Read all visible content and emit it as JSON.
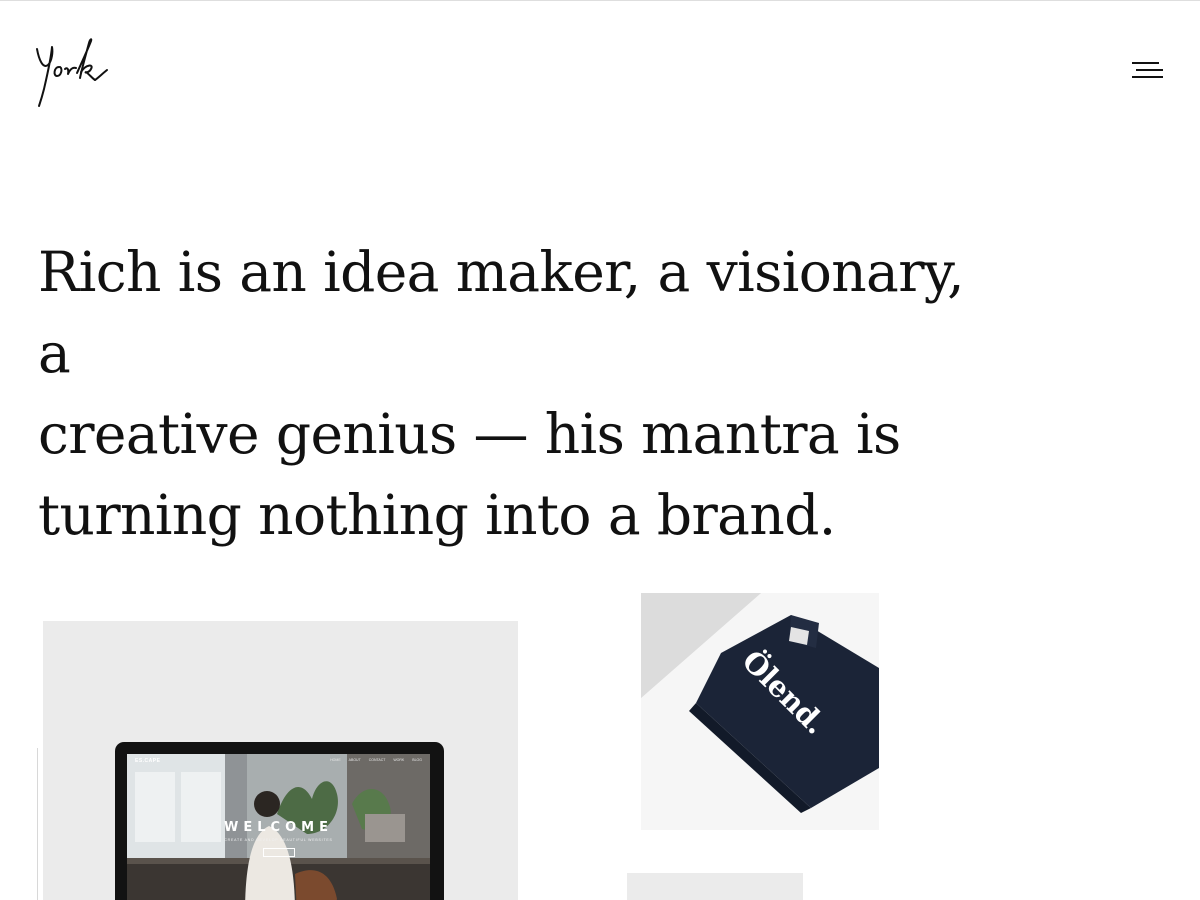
{
  "header": {
    "logo_text": "York",
    "menu_icon": "hamburger-menu-icon"
  },
  "hero": {
    "line_1": "Rich is an idea maker, a visionary, a",
    "line_2": "creative genius — his mantra is",
    "line_3": "turning nothing into a brand."
  },
  "portfolio": {
    "laptop_card": {
      "screen_brand": "ES.CAPE",
      "screen_nav": [
        "HOME",
        "ABOUT",
        "CONTACT",
        "WORK",
        "BLOG"
      ],
      "screen_headline": "WELCOME",
      "screen_subline": "CREATE AND DEVELOP BEAUTIFUL WEBSITES"
    },
    "tee_card": {
      "brand_text": "Ölend."
    }
  },
  "colors": {
    "background": "#ffffff",
    "text": "#111111",
    "card_bg": "#ebebeb",
    "tee_navy": "#1b2437"
  }
}
